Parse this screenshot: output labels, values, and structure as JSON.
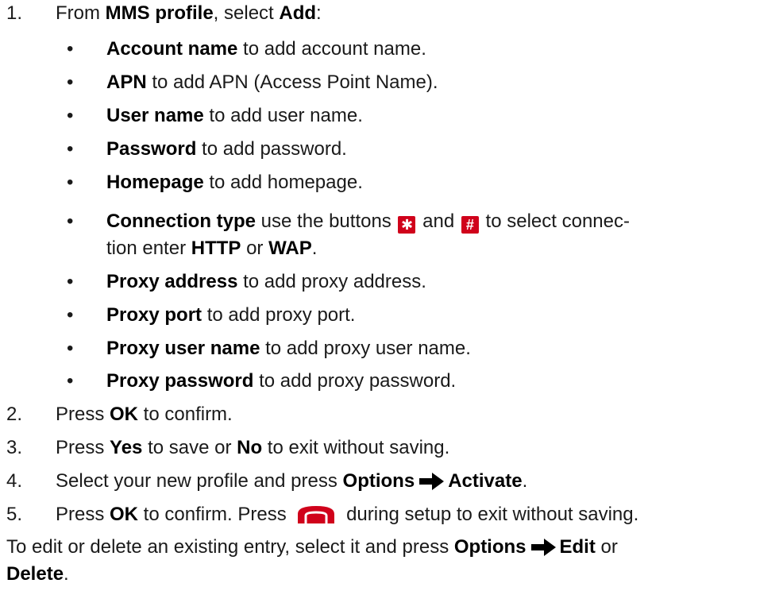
{
  "steps": {
    "s1": {
      "num": "1.",
      "pre": "From ",
      "profile": "MMS profile",
      "mid": ", select ",
      "add": "Add",
      "post": ":"
    },
    "s2": {
      "num": "2.",
      "pre": "Press ",
      "ok": "OK",
      "post": " to confirm."
    },
    "s3": {
      "num": "3.",
      "pre": "Press ",
      "yes": "Yes",
      "mid": " to save or ",
      "no": "No",
      "post": " to exit without saving."
    },
    "s4": {
      "num": "4.",
      "pre": "Select your new profile and press ",
      "options": "Options",
      "activate": "Activate",
      "post": "."
    },
    "s5": {
      "num": "5.",
      "pre": "Press ",
      "ok": "OK",
      "mid": " to confirm. Press ",
      "post": " during setup to exit without saving."
    }
  },
  "bullets": [
    {
      "term": "Account name",
      "desc": " to add account name."
    },
    {
      "term": "APN",
      "desc": " to add APN (Access Point Name)."
    },
    {
      "term": "User name",
      "desc": " to add user name."
    },
    {
      "term": "Password",
      "desc": " to add password."
    },
    {
      "term": "Homepage",
      "desc": " to add homepage."
    },
    {
      "term": "Connection type",
      "desc1": " use the buttons ",
      "key1": "✱",
      "and": " and ",
      "key2": "#",
      "desc2": " to select connec-",
      "desc3": "tion enter ",
      "http": "HTTP",
      "or": " or ",
      "wap": "WAP",
      "end": "."
    },
    {
      "term": "Proxy address",
      "desc": " to add proxy address."
    },
    {
      "term": "Proxy port",
      "desc": " to add proxy port."
    },
    {
      "term": "Proxy user name",
      "desc": " to add proxy user name."
    },
    {
      "term": "Proxy password",
      "desc": " to add proxy password."
    }
  ],
  "bullet_char": "•",
  "footer": {
    "pre": "To edit or delete an existing entry, select it and press ",
    "options": "Options",
    "edit": "Edit",
    "or": " or",
    "delete": "Delete",
    "end": "."
  },
  "colors": {
    "key_bg": "#d0021b",
    "text": "#1a1a1a"
  },
  "icons": {
    "arrow": "right-arrow-icon",
    "end_call": "end-call-key-icon"
  }
}
